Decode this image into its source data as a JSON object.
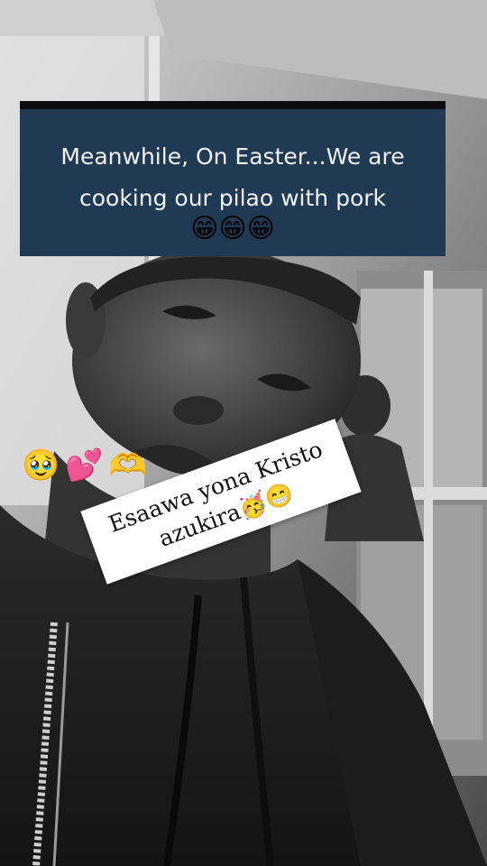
{
  "caption": {
    "text": "Meanwhile, On Easter...We are cooking our pilao with pork",
    "emoji": "😁😁😁"
  },
  "emoji_row": "🥹💕🫶",
  "sticker": {
    "line1": "Esaawa yona Kristo",
    "line2": "azukira🥳😁"
  },
  "colors": {
    "caption_bg": "#1f3a52",
    "caption_text": "#f1f1f1",
    "sticker_bg": "#ffffff"
  }
}
